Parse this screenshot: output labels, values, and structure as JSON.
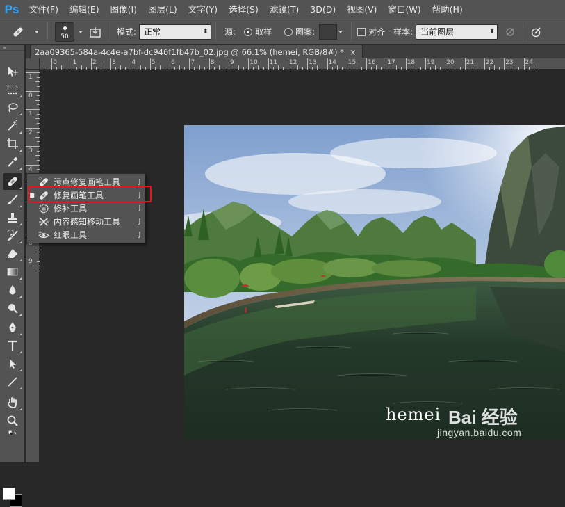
{
  "app": {
    "logo": "Ps",
    "menu": [
      "文件(F)",
      "编辑(E)",
      "图像(I)",
      "图层(L)",
      "文字(Y)",
      "选择(S)",
      "滤镜(T)",
      "3D(D)",
      "视图(V)",
      "窗口(W)",
      "帮助(H)"
    ]
  },
  "options": {
    "brush_size": "50",
    "mode_label": "模式:",
    "mode_value": "正常",
    "source_label": "源:",
    "source_sampled": "取样",
    "source_pattern": "图案:",
    "aligned_label": "对齐",
    "sample_label": "样本:",
    "sample_value": "当前图层"
  },
  "document": {
    "tab_title": "2aa09365-584a-4c4e-a7bf-dc946f1fb47b_02.jpg @ 66.1% (hemei, RGB/8#) *",
    "close_glyph": "×",
    "watermark_text": "hemei",
    "baidu_logo": "Bai 经验",
    "baidu_url": "jingyan.baidu.com"
  },
  "rulers": {
    "top_numbers": [
      "1",
      "0",
      "1",
      "2",
      "3",
      "4",
      "5",
      "6",
      "7",
      "8",
      "9",
      "10",
      "11",
      "12",
      "13",
      "14",
      "15",
      "16",
      "17",
      "18",
      "19",
      "20",
      "21",
      "22",
      "23",
      "24"
    ],
    "left_numbers": [
      "1",
      "0",
      "1",
      "2",
      "3",
      "4",
      "5",
      "6",
      "7",
      "8",
      "9"
    ]
  },
  "flyout": {
    "items": [
      {
        "label": "污点修复画笔工具",
        "key": "J",
        "selected": false
      },
      {
        "label": "修复画笔工具",
        "key": "J",
        "selected": true
      },
      {
        "label": "修补工具",
        "key": "J",
        "selected": false
      },
      {
        "label": "内容感知移动工具",
        "key": "J",
        "selected": false
      },
      {
        "label": "红眼工具",
        "key": "J",
        "selected": false
      }
    ]
  },
  "colors": {
    "accent": "#31a8ff",
    "highlight": "#e8141d",
    "foreground": "#ffffff",
    "background": "#000000"
  }
}
